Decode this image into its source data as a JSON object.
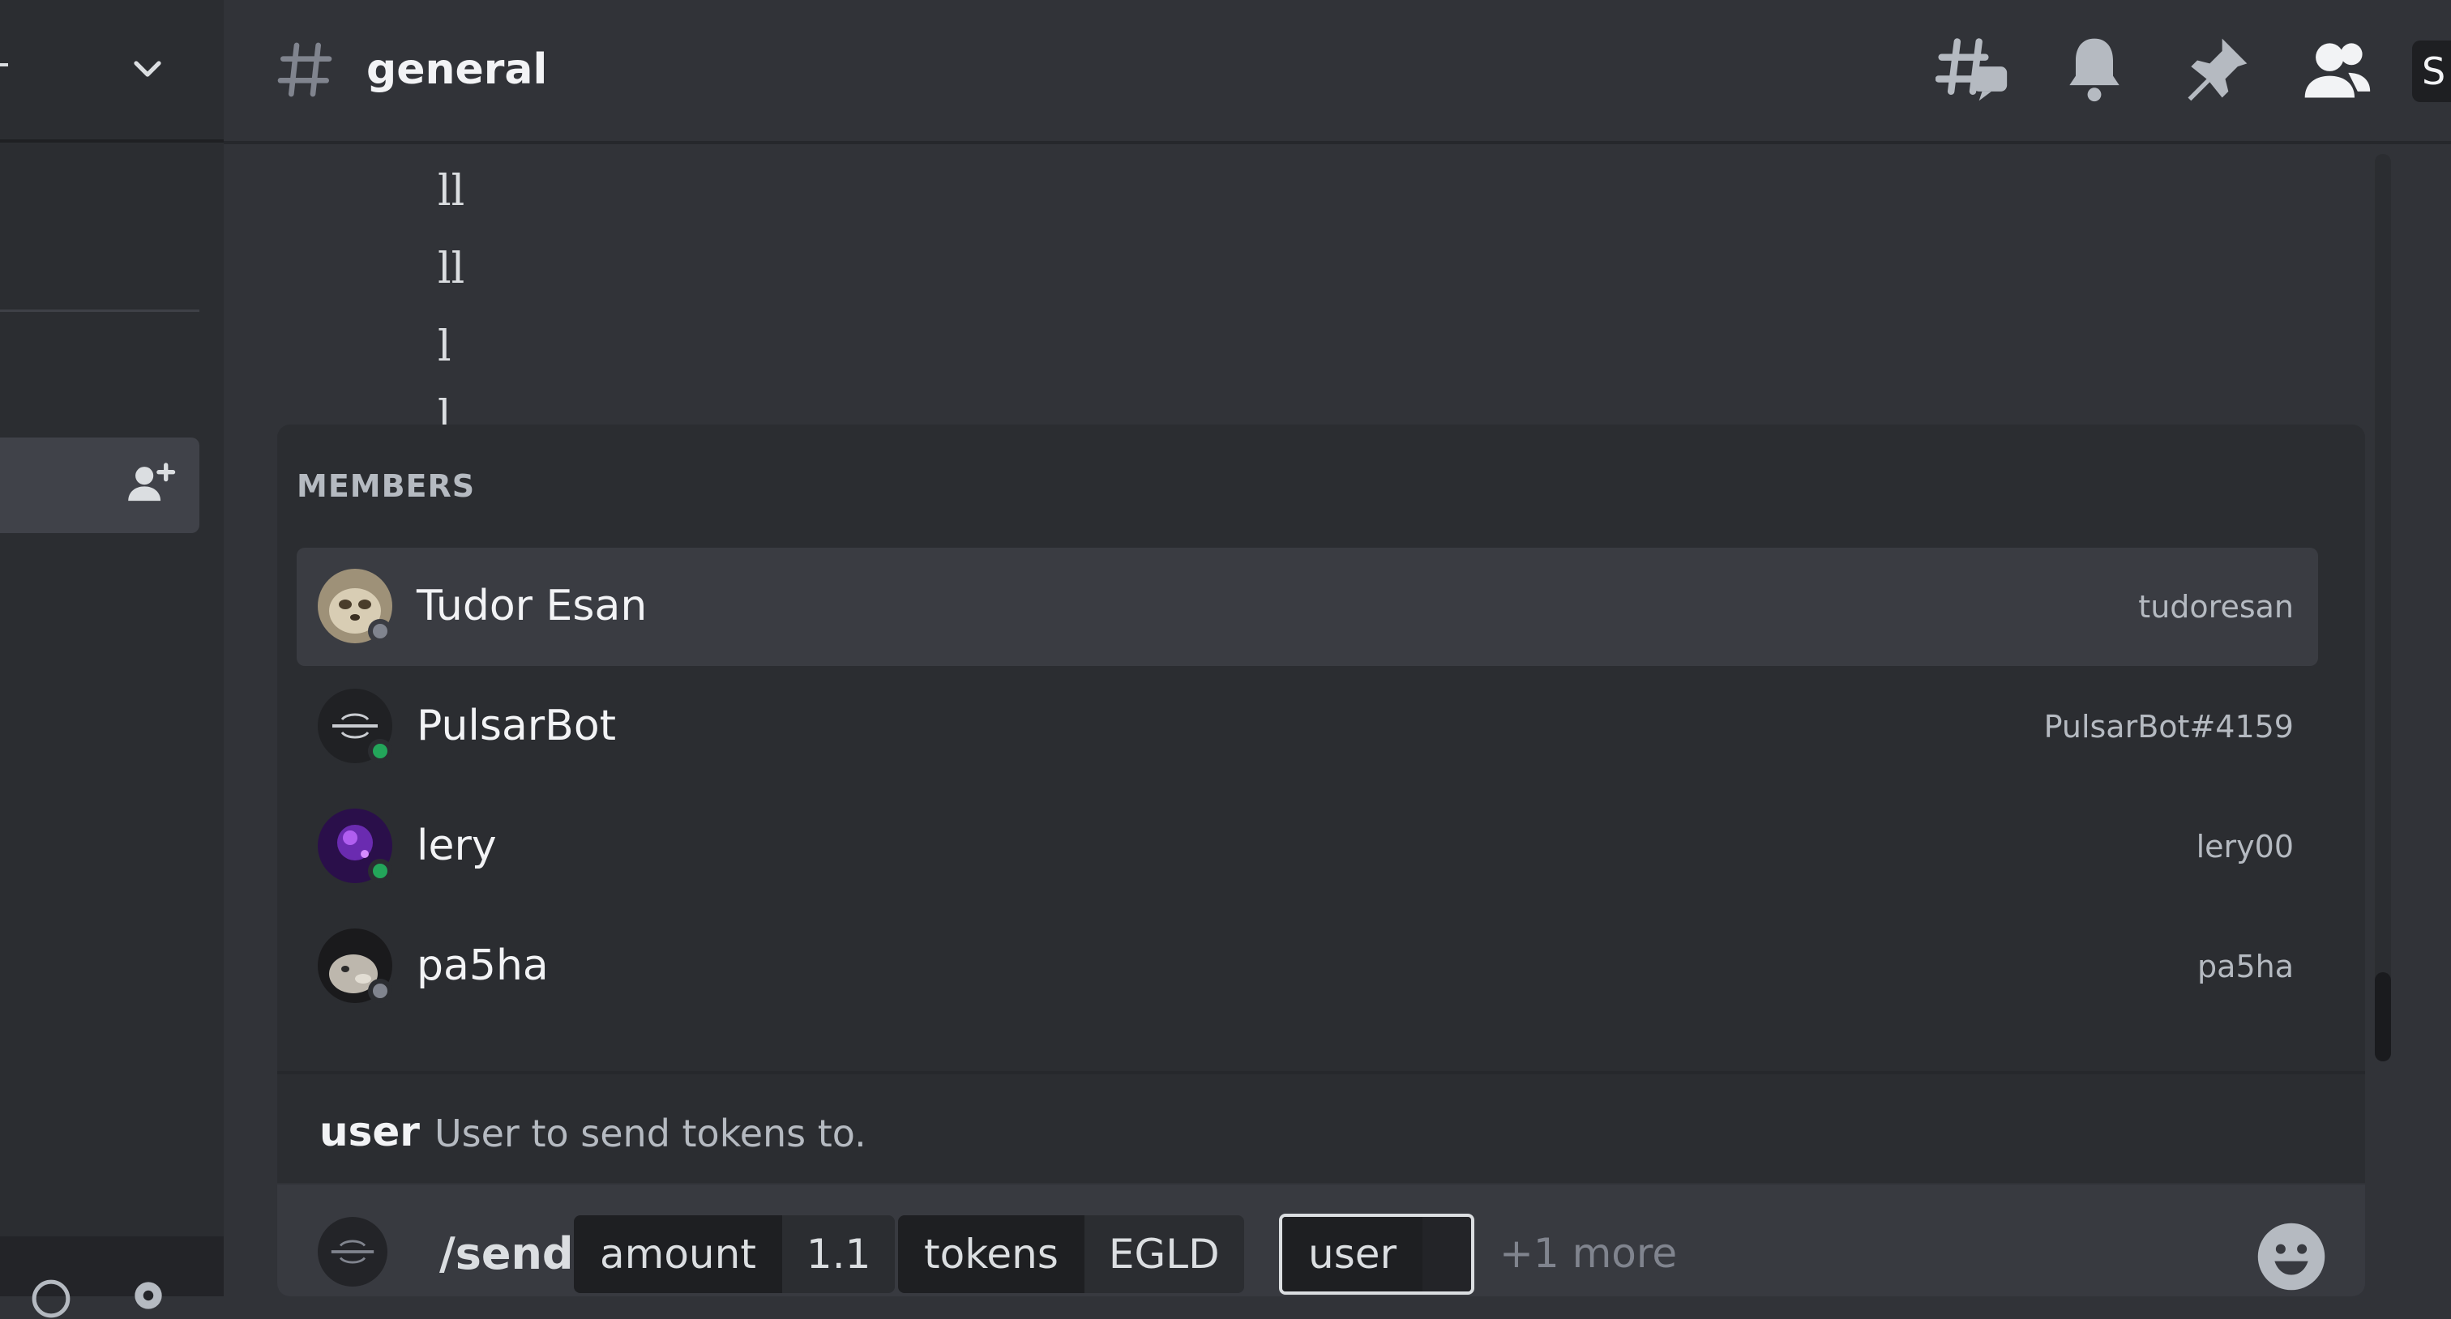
{
  "channel": {
    "name": "general"
  },
  "header_icons": [
    "threads-icon",
    "notification-bell-icon",
    "pinned-messages-icon",
    "member-list-icon"
  ],
  "header_search_stub": "S",
  "messages": [
    "ll",
    "ll",
    "l",
    "l"
  ],
  "autocomplete": {
    "section_label": "MEMBERS",
    "members": [
      {
        "display_name": "Tudor Esan",
        "handle": "tudoresan",
        "status": "offline",
        "avatar": "sloth-avatar"
      },
      {
        "display_name": "PulsarBot",
        "handle": "PulsarBot#4159",
        "status": "online",
        "avatar": "pulsar-logo-avatar"
      },
      {
        "display_name": "lery",
        "handle": "lery00",
        "status": "online",
        "avatar": "purple-galaxy-avatar"
      },
      {
        "display_name": "pa5ha",
        "handle": "pa5ha",
        "status": "offline",
        "avatar": "hedgehog-avatar"
      }
    ],
    "option_name": "user",
    "option_description": "User to send tokens to."
  },
  "composer": {
    "command": "/send",
    "params": [
      {
        "name": "amount",
        "value": "1.1"
      },
      {
        "name": "tokens",
        "value": "EGLD"
      },
      {
        "name": "user",
        "value": ""
      }
    ],
    "more": "+1 more"
  },
  "colors": {
    "online": "#23a55a",
    "offline": "#80848e",
    "background": "#313338",
    "sidebar": "#2b2d31"
  }
}
